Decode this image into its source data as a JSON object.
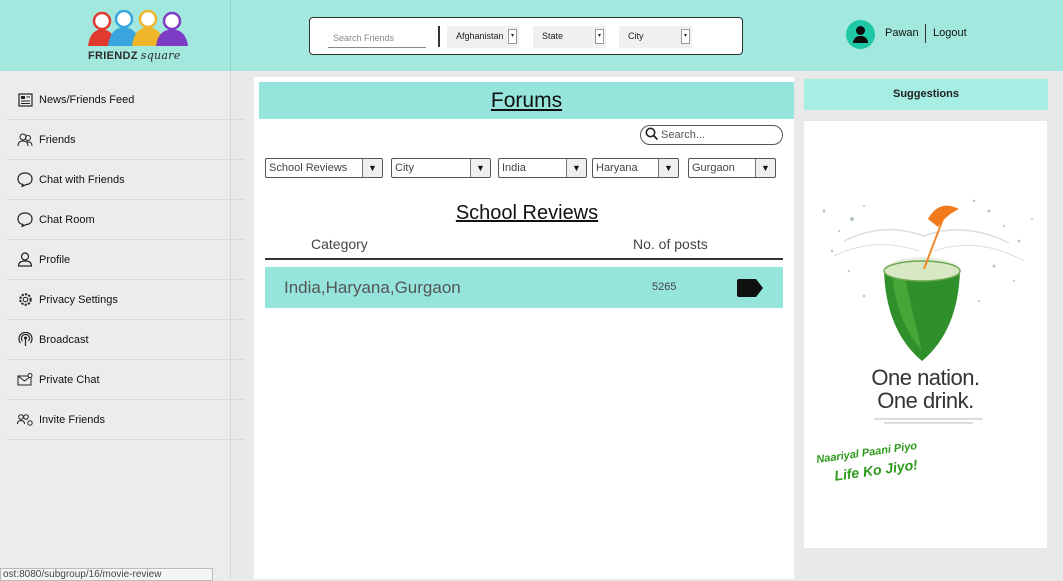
{
  "header": {
    "logo": {
      "brand": "FRIENDZ",
      "brand_suffix": "square"
    },
    "search": {
      "placeholder": "Search Friends",
      "country": "Afghanistan",
      "state": "State",
      "city": "City"
    },
    "user": {
      "name": "Pawan",
      "logout_label": "Logout"
    }
  },
  "sidebar": {
    "items": [
      {
        "label": "News/Friends Feed",
        "icon": "newspaper-icon"
      },
      {
        "label": "Friends",
        "icon": "friends-icon"
      },
      {
        "label": "Chat with Friends",
        "icon": "chat-bubble-icon"
      },
      {
        "label": "Chat Room",
        "icon": "chat-bubble-icon"
      },
      {
        "label": "Profile",
        "icon": "person-icon"
      },
      {
        "label": "Privacy Settings",
        "icon": "gear-icon"
      },
      {
        "label": "Broadcast",
        "icon": "broadcast-icon"
      },
      {
        "label": "Private Chat",
        "icon": "envelope-icon"
      },
      {
        "label": "Invite Friends",
        "icon": "invite-icon"
      }
    ]
  },
  "status_url": "ost:8080/subgroup/16/movie-review",
  "main": {
    "title": "Forums",
    "search_placeholder": "Search...",
    "filters": [
      "School Reviews",
      "City",
      "India",
      "Haryana",
      "Gurgaon"
    ],
    "section_title": "School Reviews",
    "columns": {
      "category": "Category",
      "posts": "No. of posts"
    },
    "rows": [
      {
        "name": "India,Haryana,Gurgaon",
        "posts": "5265"
      }
    ]
  },
  "right": {
    "suggestions_label": "Suggestions",
    "ad": {
      "line1": "One nation.",
      "line2": "One drink.",
      "tag1": "Naariyal Paani Piyo",
      "tag2": "Life Ko Jiyo!"
    }
  },
  "colors": {
    "header_bg": "#a3e8de",
    "accent": "#95e5dd",
    "avatar": "#1ec7a6"
  }
}
